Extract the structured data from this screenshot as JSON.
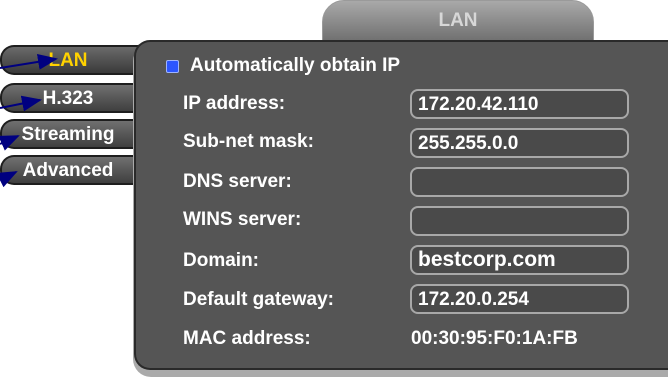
{
  "panel_title": "LAN",
  "side_tabs": [
    {
      "label": "LAN",
      "active": true
    },
    {
      "label": "H.323",
      "active": false
    },
    {
      "label": "Streaming",
      "active": false
    },
    {
      "label": "Advanced",
      "active": false
    }
  ],
  "auto_ip": {
    "label": "Automatically obtain IP",
    "selected": true
  },
  "fields": {
    "ip_address": {
      "label": "IP address:",
      "value": "172.20.42.110"
    },
    "subnet_mask": {
      "label": "Sub-net mask:",
      "value": "255.255.0.0"
    },
    "dns_server": {
      "label": "DNS server:",
      "value": ""
    },
    "wins_server": {
      "label": "WINS server:",
      "value": ""
    },
    "domain": {
      "label": "Domain:",
      "value": "bestcorp.com"
    },
    "default_gateway": {
      "label": "Default gateway:",
      "value": "172.20.0.254"
    },
    "mac_address": {
      "label": "MAC address:",
      "value": "00:30:95:F0:1A:FB"
    }
  },
  "colors": {
    "active_tab_text": "#ffd200",
    "panel_bg": "#555555",
    "radio_selected": "#2b55ff",
    "callout_arrow": "#000080"
  }
}
